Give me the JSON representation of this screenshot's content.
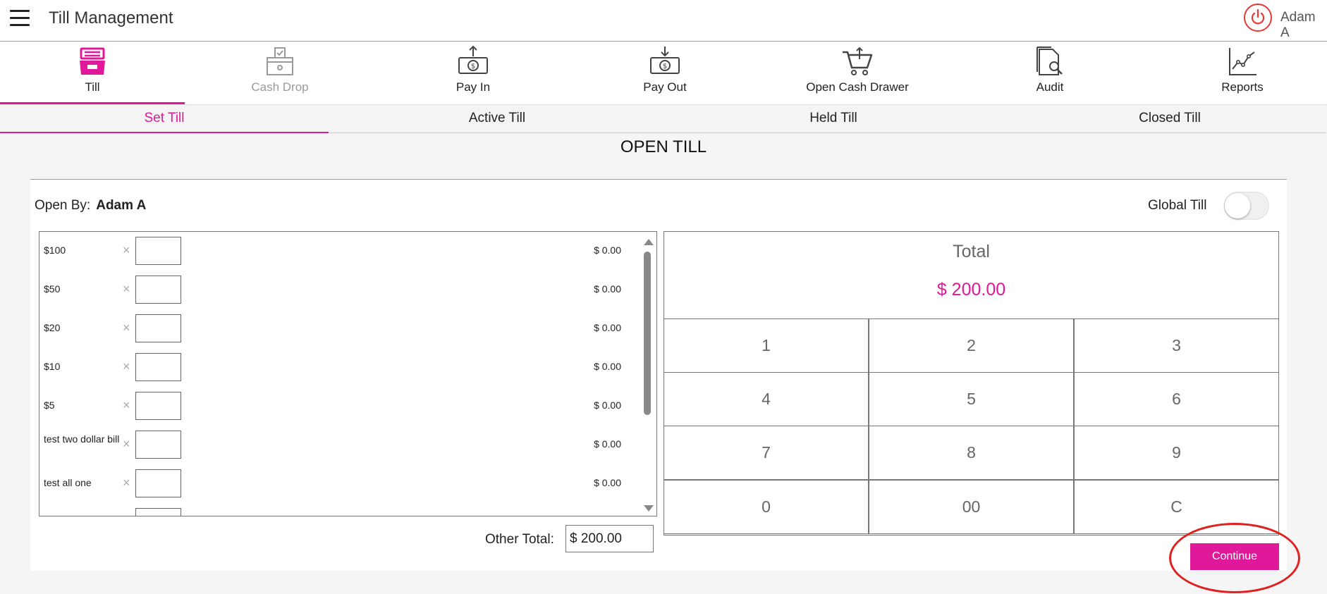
{
  "header": {
    "title": "Till Management",
    "user": "Adam A"
  },
  "nav": [
    {
      "label": "Till",
      "icon": "till-icon"
    },
    {
      "label": "Cash Drop",
      "icon": "cash-drop-icon"
    },
    {
      "label": "Pay In",
      "icon": "pay-in-icon"
    },
    {
      "label": "Pay Out",
      "icon": "pay-out-icon"
    },
    {
      "label": "Open Cash Drawer",
      "icon": "cart-icon"
    },
    {
      "label": "Audit",
      "icon": "audit-icon"
    },
    {
      "label": "Reports",
      "icon": "reports-icon"
    }
  ],
  "subtabs": [
    "Set Till",
    "Active Till",
    "Held Till",
    "Closed Till"
  ],
  "main": {
    "title": "OPEN TILL",
    "open_by_label": "Open By:",
    "open_by_name": "Adam A",
    "global_till_label": "Global Till",
    "global_till_on": false,
    "denominations": [
      {
        "label": "$100",
        "amount": "$ 0.00"
      },
      {
        "label": "$50",
        "amount": "$ 0.00"
      },
      {
        "label": "$20",
        "amount": "$ 0.00"
      },
      {
        "label": "$10",
        "amount": "$ 0.00"
      },
      {
        "label": "$5",
        "amount": "$ 0.00"
      },
      {
        "label": "test two dollar bill",
        "amount": "$ 0.00"
      },
      {
        "label": "test all one",
        "amount": "$ 0.00"
      }
    ],
    "other_total_label": "Other Total:",
    "other_total_value": "$ 200.00",
    "total_label": "Total",
    "total_value": "$ 200.00",
    "keypad": [
      "1",
      "2",
      "3",
      "4",
      "5",
      "6",
      "7",
      "8",
      "9",
      "0",
      "00",
      "C"
    ],
    "continue_label": "Continue"
  },
  "colors": {
    "accent": "#e0189a",
    "power": "#e53935",
    "highlight": "#e01f1f"
  }
}
